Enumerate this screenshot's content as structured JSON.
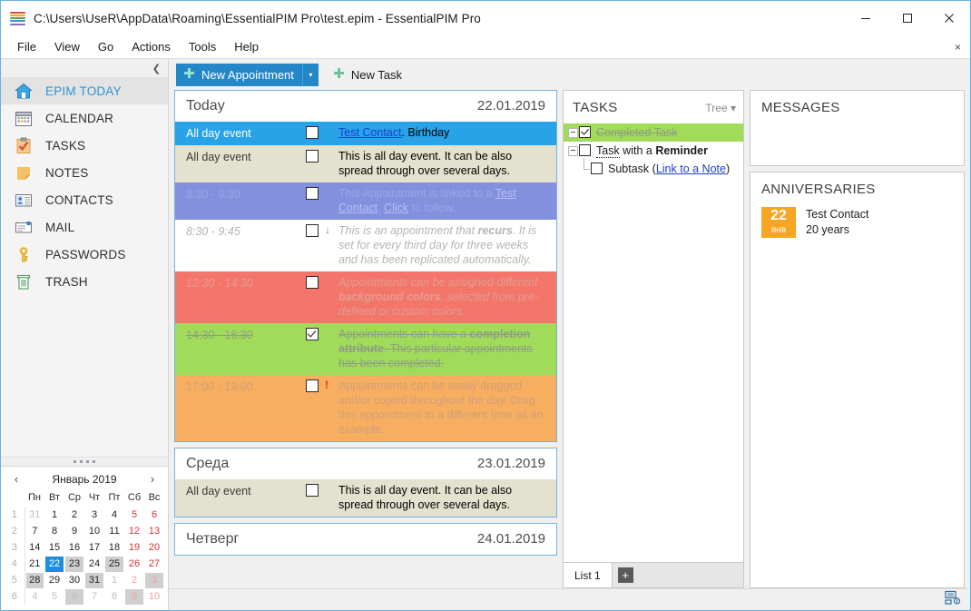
{
  "window": {
    "title": "C:\\Users\\UseR\\AppData\\Roaming\\EssentialPIM Pro\\test.epim - EssentialPIM Pro",
    "minimize_label": "Minimize",
    "maximize_label": "Maximize",
    "close_label": "Close",
    "accent_color": "#2487c8"
  },
  "menubar": {
    "items": [
      {
        "label": "File"
      },
      {
        "label": "View"
      },
      {
        "label": "Go"
      },
      {
        "label": "Actions"
      },
      {
        "label": "Tools"
      },
      {
        "label": "Help"
      }
    ],
    "close_label": "×"
  },
  "sidebar": {
    "collapse_label": "❮",
    "items": [
      {
        "label": "EPIM TODAY",
        "icon": "home-icon",
        "active": true
      },
      {
        "label": "CALENDAR",
        "icon": "calendar-icon",
        "active": false
      },
      {
        "label": "TASKS",
        "icon": "tasks-icon",
        "active": false
      },
      {
        "label": "NOTES",
        "icon": "notes-icon",
        "active": false
      },
      {
        "label": "CONTACTS",
        "icon": "contacts-icon",
        "active": false
      },
      {
        "label": "MAIL",
        "icon": "mail-icon",
        "active": false
      },
      {
        "label": "PASSWORDS",
        "icon": "key-icon",
        "active": false
      },
      {
        "label": "TRASH",
        "icon": "trash-icon",
        "active": false
      }
    ]
  },
  "mini_calendar": {
    "prev_label": "‹",
    "next_label": "›",
    "title": "Январь 2019",
    "weekday_headers": [
      "Пн",
      "Вт",
      "Ср",
      "Чт",
      "Пт",
      "Сб",
      "Вс"
    ],
    "weeks": [
      {
        "num": "1",
        "days": [
          {
            "d": "31",
            "other": true,
            "weekend": false,
            "shaded": false,
            "today": false
          },
          {
            "d": "1",
            "other": false,
            "weekend": false,
            "shaded": false,
            "today": false
          },
          {
            "d": "2",
            "other": false,
            "weekend": false,
            "shaded": false,
            "today": false
          },
          {
            "d": "3",
            "other": false,
            "weekend": false,
            "shaded": false,
            "today": false
          },
          {
            "d": "4",
            "other": false,
            "weekend": false,
            "shaded": false,
            "today": false
          },
          {
            "d": "5",
            "other": false,
            "weekend": true,
            "shaded": false,
            "today": false
          },
          {
            "d": "6",
            "other": false,
            "weekend": true,
            "shaded": false,
            "today": false
          }
        ]
      },
      {
        "num": "2",
        "days": [
          {
            "d": "7",
            "other": false,
            "weekend": false,
            "shaded": false,
            "today": false
          },
          {
            "d": "8",
            "other": false,
            "weekend": false,
            "shaded": false,
            "today": false
          },
          {
            "d": "9",
            "other": false,
            "weekend": false,
            "shaded": false,
            "today": false
          },
          {
            "d": "10",
            "other": false,
            "weekend": false,
            "shaded": false,
            "today": false
          },
          {
            "d": "11",
            "other": false,
            "weekend": false,
            "shaded": false,
            "today": false
          },
          {
            "d": "12",
            "other": false,
            "weekend": true,
            "shaded": false,
            "today": false
          },
          {
            "d": "13",
            "other": false,
            "weekend": true,
            "shaded": false,
            "today": false
          }
        ]
      },
      {
        "num": "3",
        "days": [
          {
            "d": "14",
            "other": false,
            "weekend": false,
            "shaded": false,
            "today": false
          },
          {
            "d": "15",
            "other": false,
            "weekend": false,
            "shaded": false,
            "today": false
          },
          {
            "d": "16",
            "other": false,
            "weekend": false,
            "shaded": false,
            "today": false
          },
          {
            "d": "17",
            "other": false,
            "weekend": false,
            "shaded": false,
            "today": false
          },
          {
            "d": "18",
            "other": false,
            "weekend": false,
            "shaded": false,
            "today": false
          },
          {
            "d": "19",
            "other": false,
            "weekend": true,
            "shaded": false,
            "today": false
          },
          {
            "d": "20",
            "other": false,
            "weekend": true,
            "shaded": false,
            "today": false
          }
        ]
      },
      {
        "num": "4",
        "days": [
          {
            "d": "21",
            "other": false,
            "weekend": false,
            "shaded": false,
            "today": false
          },
          {
            "d": "22",
            "other": false,
            "weekend": false,
            "shaded": false,
            "today": true
          },
          {
            "d": "23",
            "other": false,
            "weekend": false,
            "shaded": true,
            "today": false
          },
          {
            "d": "24",
            "other": false,
            "weekend": false,
            "shaded": false,
            "today": false
          },
          {
            "d": "25",
            "other": false,
            "weekend": false,
            "shaded": true,
            "today": false
          },
          {
            "d": "26",
            "other": false,
            "weekend": true,
            "shaded": false,
            "today": false
          },
          {
            "d": "27",
            "other": false,
            "weekend": true,
            "shaded": false,
            "today": false
          }
        ]
      },
      {
        "num": "5",
        "days": [
          {
            "d": "28",
            "other": false,
            "weekend": false,
            "shaded": true,
            "today": false
          },
          {
            "d": "29",
            "other": false,
            "weekend": false,
            "shaded": false,
            "today": false
          },
          {
            "d": "30",
            "other": false,
            "weekend": false,
            "shaded": false,
            "today": false
          },
          {
            "d": "31",
            "other": false,
            "weekend": false,
            "shaded": true,
            "today": false
          },
          {
            "d": "1",
            "other": true,
            "weekend": false,
            "shaded": false,
            "today": false
          },
          {
            "d": "2",
            "other": true,
            "weekend": true,
            "shaded": false,
            "today": false
          },
          {
            "d": "3",
            "other": true,
            "weekend": true,
            "shaded": true,
            "today": false
          }
        ]
      },
      {
        "num": "6",
        "days": [
          {
            "d": "4",
            "other": true,
            "weekend": false,
            "shaded": false,
            "today": false
          },
          {
            "d": "5",
            "other": true,
            "weekend": false,
            "shaded": false,
            "today": false
          },
          {
            "d": "6",
            "other": true,
            "weekend": false,
            "shaded": true,
            "today": false
          },
          {
            "d": "7",
            "other": true,
            "weekend": false,
            "shaded": false,
            "today": false
          },
          {
            "d": "8",
            "other": true,
            "weekend": false,
            "shaded": false,
            "today": false
          },
          {
            "d": "9",
            "other": true,
            "weekend": true,
            "shaded": true,
            "today": false
          },
          {
            "d": "10",
            "other": true,
            "weekend": true,
            "shaded": false,
            "today": false
          }
        ]
      }
    ]
  },
  "toolbar": {
    "new_appointment_label": "New Appointment",
    "new_appointment_dropdown": "▾",
    "new_task_label": "New Task",
    "plus_glyph": "✚"
  },
  "today_pane": {
    "days": [
      {
        "name": "Today",
        "date": "22.01.2019",
        "appointments": [
          {
            "time": "All day event",
            "style": "sel",
            "checked": false,
            "priority": "",
            "text_parts": [
              {
                "t": "Test Contact",
                "link": true
              },
              {
                "t": ". Birthday",
                "link": false
              }
            ]
          },
          {
            "time": "All day event",
            "style": "beige",
            "checked": false,
            "priority": "",
            "text_parts": [
              {
                "t": "This is all day event. It can be also spread through over several days.",
                "link": false
              }
            ]
          },
          {
            "time": "8:30 - 9:30",
            "style": "peri",
            "checked": false,
            "priority": "",
            "text_parts": [
              {
                "t": "This Appointment is linked to a ",
                "link": false
              },
              {
                "t": "Test Contact",
                "link": true
              },
              {
                "t": ". ",
                "link": false
              },
              {
                "t": "Click",
                "link": true
              },
              {
                "t": " to follow.",
                "link": false
              }
            ]
          },
          {
            "time": "8:30 - 9:45",
            "style": "white",
            "checked": false,
            "priority": "low",
            "text_parts": [
              {
                "t": "This is an appointment that ",
                "link": false
              },
              {
                "t": "recurs",
                "link": false,
                "bold": true
              },
              {
                "t": ". It is set for every third day for three weeks and has been replicated automatically.",
                "link": false
              }
            ]
          },
          {
            "time": "12:30 - 14:30",
            "style": "salmon",
            "checked": false,
            "priority": "",
            "text_parts": [
              {
                "t": "Appointments can be assigned different ",
                "link": false
              },
              {
                "t": "background colors",
                "link": false,
                "bold": true
              },
              {
                "t": ", selected from pre-defined or custom colors.",
                "link": false
              }
            ]
          },
          {
            "time": "14:30 - 16:30",
            "style": "green",
            "checked": true,
            "priority": "",
            "text_parts": [
              {
                "t": "Appointments can have a ",
                "link": false
              },
              {
                "t": "completion attribute",
                "link": false,
                "bold": true
              },
              {
                "t": ". This particular appointments has been completed.",
                "link": false
              }
            ]
          },
          {
            "time": "17:00 - 19:00",
            "style": "orange",
            "checked": false,
            "priority": "high",
            "text_parts": [
              {
                "t": "Appointments can be easily dragged and/or copied throughout the day. Drag this appointment to a different time as an example.",
                "link": false
              }
            ]
          }
        ]
      },
      {
        "name": "Среда",
        "date": "23.01.2019",
        "appointments": [
          {
            "time": "All day event",
            "style": "beige",
            "checked": false,
            "priority": "",
            "text_parts": [
              {
                "t": "This is all day event. It can be also spread through over several days.",
                "link": false
              }
            ]
          }
        ]
      },
      {
        "name": "Четверг",
        "date": "24.01.2019",
        "appointments": []
      }
    ]
  },
  "tasks_pane": {
    "title": "TASKS",
    "view_mode": "Tree",
    "view_mode_caret": "▾",
    "rows": [
      {
        "indent": 0,
        "expander": true,
        "elbow": false,
        "checked": true,
        "done": true,
        "parts": [
          {
            "t": "Completed Task",
            "link": false
          }
        ]
      },
      {
        "indent": 0,
        "expander": true,
        "elbow": false,
        "checked": false,
        "done": false,
        "parts": [
          {
            "t": "Task",
            "link": false,
            "dotted": true
          },
          {
            "t": " with a ",
            "link": false
          },
          {
            "t": "Reminder",
            "link": false,
            "bold": true
          }
        ]
      },
      {
        "indent": 1,
        "expander": false,
        "elbow": true,
        "checked": false,
        "done": false,
        "parts": [
          {
            "t": "Subtask (",
            "link": false
          },
          {
            "t": "Link to a Note",
            "link": true
          },
          {
            "t": ")",
            "link": false
          }
        ]
      }
    ],
    "tabs": {
      "active_label": "List 1",
      "add_label": "+"
    }
  },
  "messages_pane": {
    "title": "MESSAGES",
    "items": []
  },
  "anniversaries_pane": {
    "title": "ANNIVERSARIES",
    "items": [
      {
        "day": "22",
        "month": "янв",
        "name": "Test Contact",
        "detail": "20 years",
        "color": "#f5a623"
      }
    ]
  },
  "statusbar": {
    "sync_icon": "sync-icon"
  }
}
